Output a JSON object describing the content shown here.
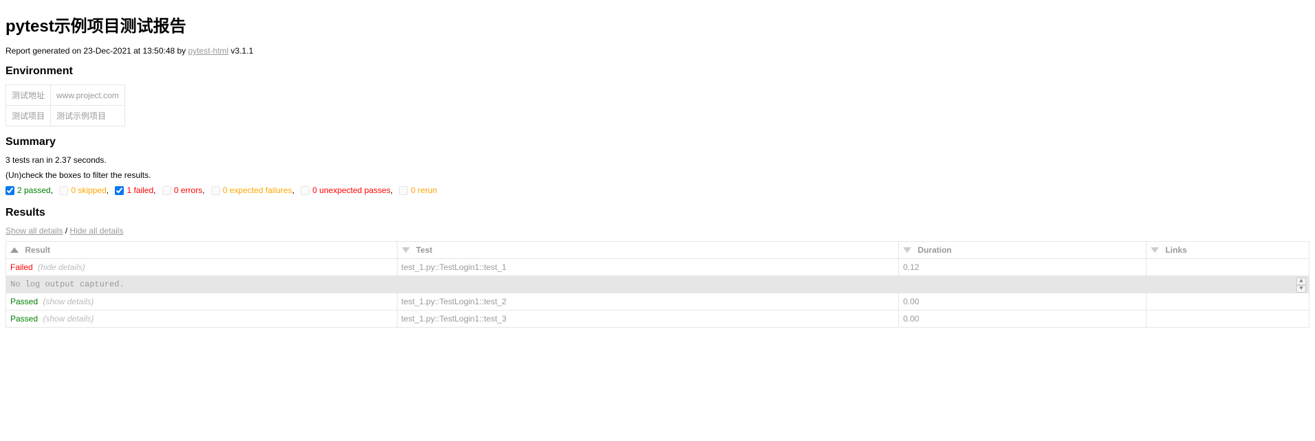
{
  "title": "pytest示例项目测试报告",
  "generated": {
    "prefix": "Report generated on 23-Dec-2021 at 13:50:48 by ",
    "link_text": "pytest-html",
    "version": " v3.1.1"
  },
  "sections": {
    "environment": "Environment",
    "summary": "Summary",
    "results": "Results"
  },
  "environment": [
    {
      "key": "测试地址",
      "value": "www.project.com"
    },
    {
      "key": "测试项目",
      "value": "测试示例项目"
    }
  ],
  "summary": {
    "tests_ran": "3 tests ran in 2.37 seconds.",
    "filter_hint": "(Un)check the boxes to filter the results."
  },
  "filters": [
    {
      "label": "2 passed",
      "class": "passed",
      "checked": true,
      "disabled": false,
      "comma": ","
    },
    {
      "label": "0 skipped",
      "class": "skipped",
      "checked": false,
      "disabled": true,
      "comma": ","
    },
    {
      "label": "1 failed",
      "class": "failed",
      "checked": true,
      "disabled": false,
      "comma": ","
    },
    {
      "label": "0 errors",
      "class": "error",
      "checked": false,
      "disabled": true,
      "comma": ","
    },
    {
      "label": "0 expected failures",
      "class": "skipped",
      "checked": false,
      "disabled": true,
      "comma": ","
    },
    {
      "label": "0 unexpected passes",
      "class": "error",
      "checked": false,
      "disabled": true,
      "comma": ","
    },
    {
      "label": "0 rerun",
      "class": "rerun",
      "checked": false,
      "disabled": true,
      "comma": ""
    }
  ],
  "details_links": {
    "show_all": "Show all details",
    "separator": " / ",
    "hide_all": "Hide all details"
  },
  "columns": {
    "result": "Result",
    "test": "Test",
    "duration": "Duration",
    "links": "Links"
  },
  "col_widths": {
    "result": "30%",
    "test": "38.5%",
    "duration": "19%",
    "links": "12.5%"
  },
  "rows": [
    {
      "result": "Failed",
      "result_class": "result-failed",
      "toggle": "(hide details)",
      "test": "test_1.py::TestLogin1::test_1",
      "duration": "0.12",
      "links": "",
      "log": "No log output captured."
    },
    {
      "result": "Passed",
      "result_class": "result-passed",
      "toggle": "(show details)",
      "test": "test_1.py::TestLogin1::test_2",
      "duration": "0.00",
      "links": ""
    },
    {
      "result": "Passed",
      "result_class": "result-passed",
      "toggle": "(show details)",
      "test": "test_1.py::TestLogin1::test_3",
      "duration": "0.00",
      "links": ""
    }
  ]
}
